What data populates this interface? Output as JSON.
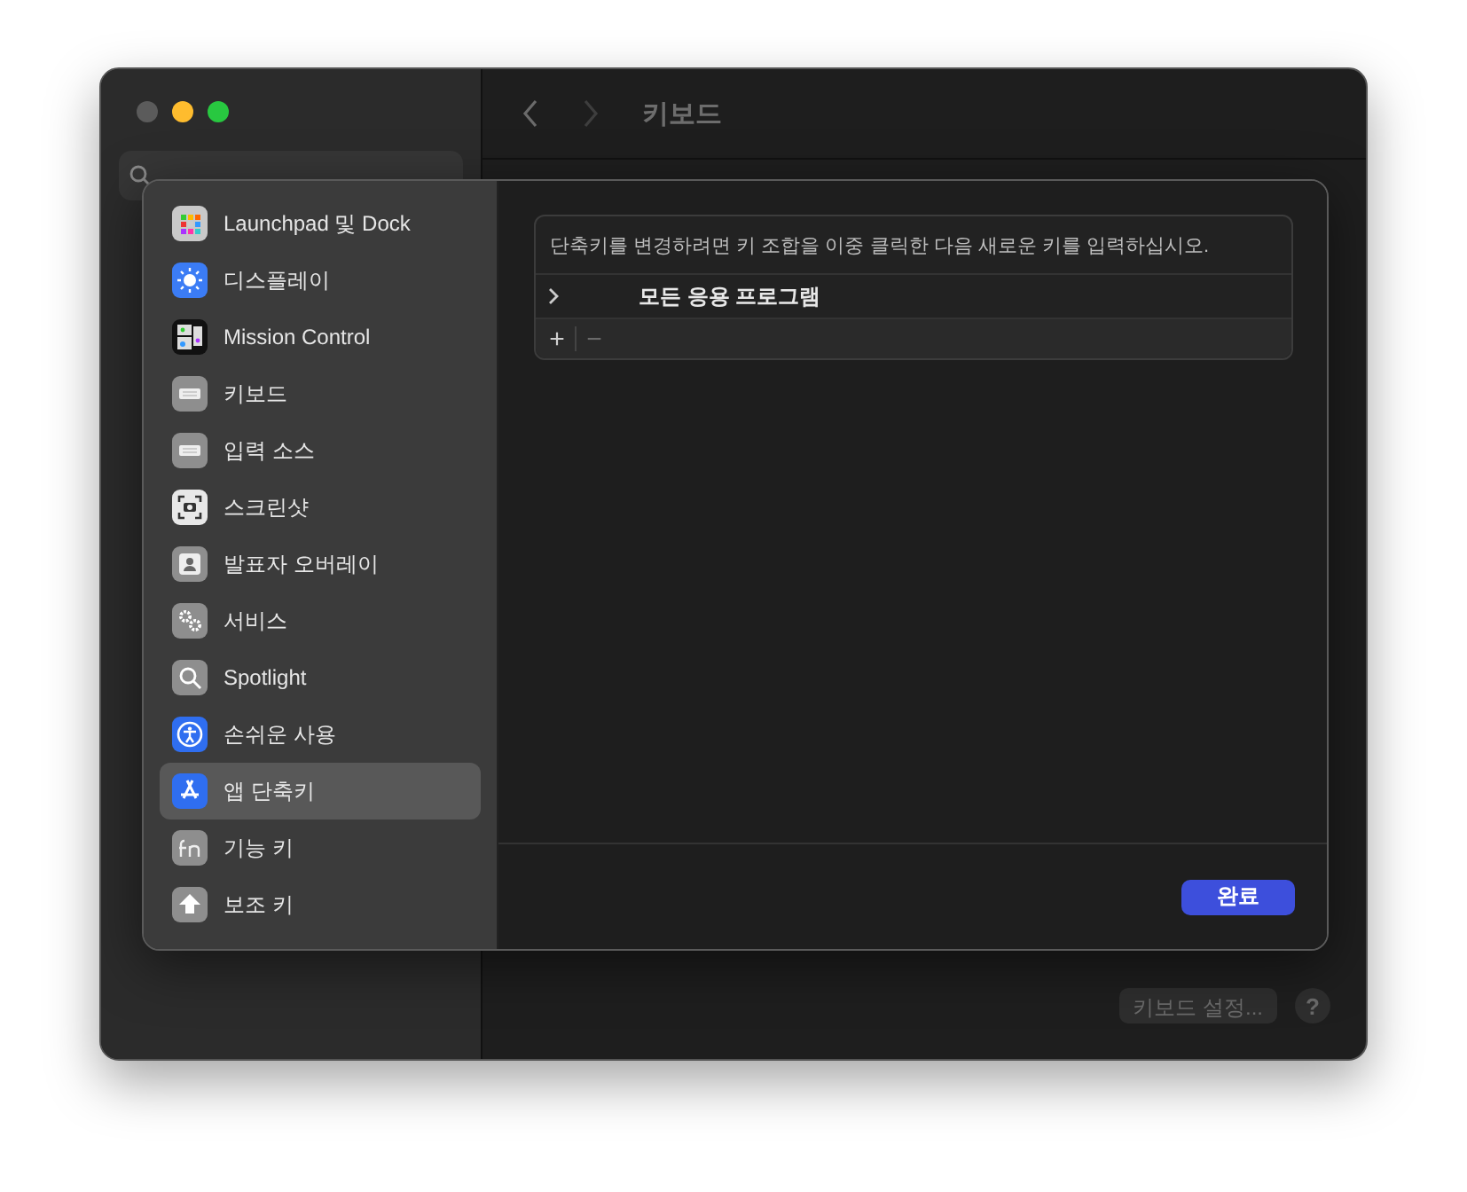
{
  "window": {
    "title": "키보드"
  },
  "sheet": {
    "items": [
      {
        "label": "Launchpad 및 Dock",
        "kind": "launchpad",
        "selected": false
      },
      {
        "label": "디스플레이",
        "kind": "display",
        "selected": false
      },
      {
        "label": "Mission Control",
        "kind": "mission",
        "selected": false
      },
      {
        "label": "키보드",
        "kind": "keyboard",
        "selected": false
      },
      {
        "label": "입력 소스",
        "kind": "keyboard",
        "selected": false
      },
      {
        "label": "스크린샷",
        "kind": "screenshot",
        "selected": false
      },
      {
        "label": "발표자 오버레이",
        "kind": "presenter",
        "selected": false
      },
      {
        "label": "서비스",
        "kind": "gears",
        "selected": false
      },
      {
        "label": "Spotlight",
        "kind": "search",
        "selected": false
      },
      {
        "label": "손쉬운 사용",
        "kind": "accessibility",
        "selected": false
      },
      {
        "label": "앱 단축키",
        "kind": "appstore",
        "selected": true
      },
      {
        "label": "기능 키",
        "kind": "fn",
        "selected": false
      },
      {
        "label": "보조 키",
        "kind": "arrow",
        "selected": false
      }
    ],
    "hint": "단축키를 변경하려면 키 조합을 이중 클릭한 다음 새로운 키를 입력하십시오.",
    "rows": [
      {
        "label": "모든 응용 프로그램",
        "expanded": false
      }
    ],
    "add_button": "+",
    "remove_button": "−",
    "done_button": "완료"
  },
  "footer": {
    "settings_button": "키보드 설정...",
    "help_button": "?"
  }
}
